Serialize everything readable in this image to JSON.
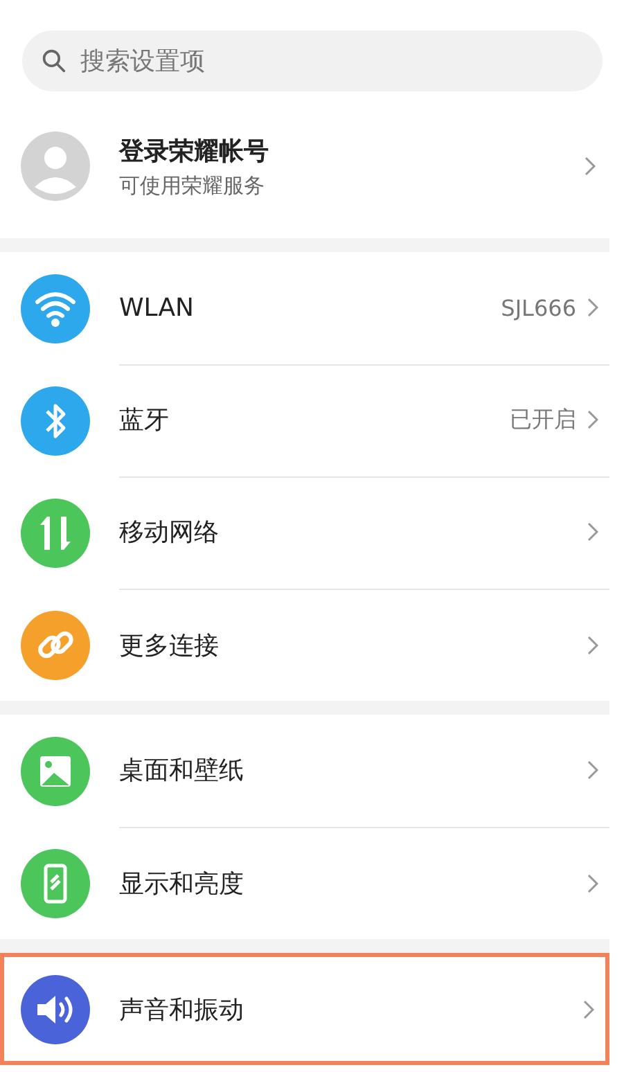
{
  "search": {
    "placeholder": "搜索设置项"
  },
  "account": {
    "title": "登录荣耀帐号",
    "subtitle": "可使用荣耀服务"
  },
  "sections": [
    {
      "items": [
        {
          "kind": "wifi",
          "color": "#2ea8ec",
          "label": "WLAN",
          "value": "SJL666",
          "selected": false
        },
        {
          "kind": "bluetooth",
          "color": "#2ea8ec",
          "label": "蓝牙",
          "value": "已开启",
          "selected": false
        },
        {
          "kind": "data",
          "color": "#4cc55a",
          "label": "移动网络",
          "selected": false
        },
        {
          "kind": "link",
          "color": "#f6a02c",
          "label": "更多连接",
          "selected": false
        }
      ]
    },
    {
      "items": [
        {
          "kind": "image",
          "color": "#4cc55a",
          "label": "桌面和壁纸",
          "selected": false
        },
        {
          "kind": "phone",
          "color": "#4cc55a",
          "label": "显示和亮度",
          "selected": false
        }
      ]
    },
    {
      "items": [
        {
          "kind": "sound",
          "color": "#4b63d9",
          "label": "声音和振动",
          "selected": true
        }
      ]
    }
  ]
}
